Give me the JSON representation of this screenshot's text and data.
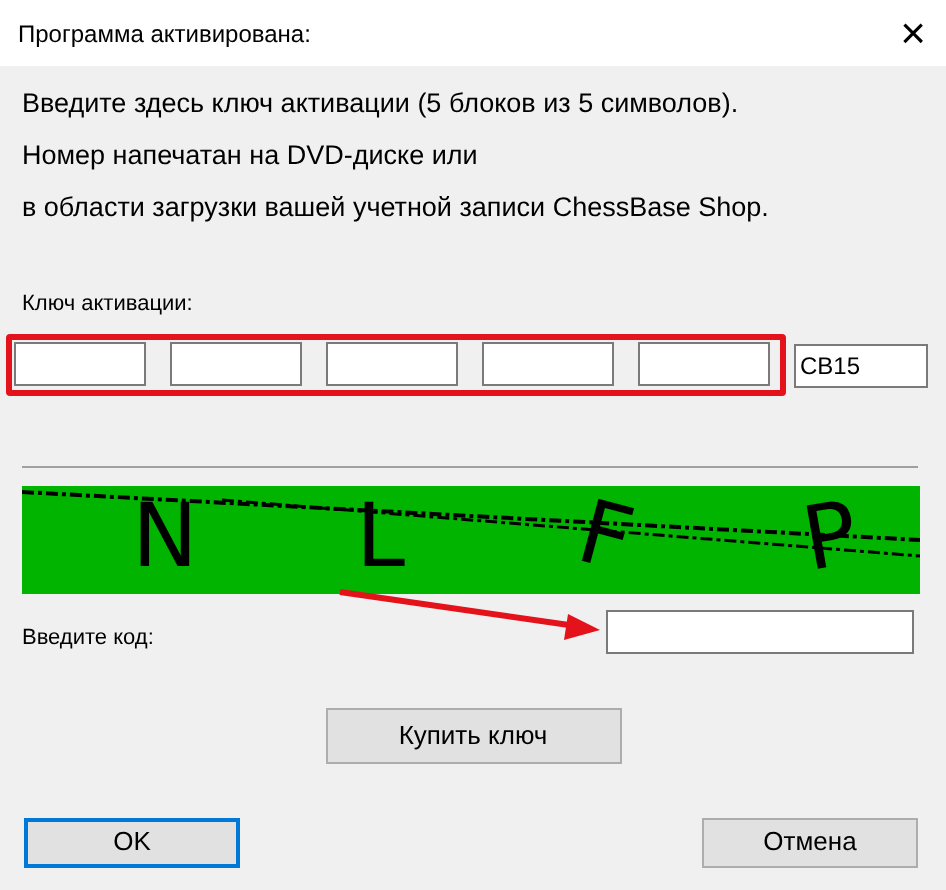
{
  "window": {
    "title": "Программа активирована:",
    "close": "×"
  },
  "instructions": [
    "Введите здесь ключ активации (5 блоков из 5 символов).",
    "Номер напечатан на DVD-диске или",
    "в области загрузки вашей учетной записи ChessBase Shop."
  ],
  "key": {
    "label": "Ключ активации:",
    "blocks": [
      {
        "kind": "empty"
      },
      {
        "kind": "empty"
      },
      {
        "kind": "empty"
      },
      {
        "kind": "empty"
      },
      {
        "kind": "empty"
      }
    ],
    "suffix": "CB15"
  },
  "captcha": {
    "letters": [
      "N",
      "L",
      "F",
      "P"
    ]
  },
  "code": {
    "label": "Введите код:"
  },
  "buttons": [
    {
      "label": "Купить ключ",
      "kind": "buy",
      "default": false
    },
    {
      "label": "OK",
      "kind": "ok",
      "default": true
    },
    {
      "label": "Отмена",
      "kind": "cancel",
      "default": false
    }
  ]
}
